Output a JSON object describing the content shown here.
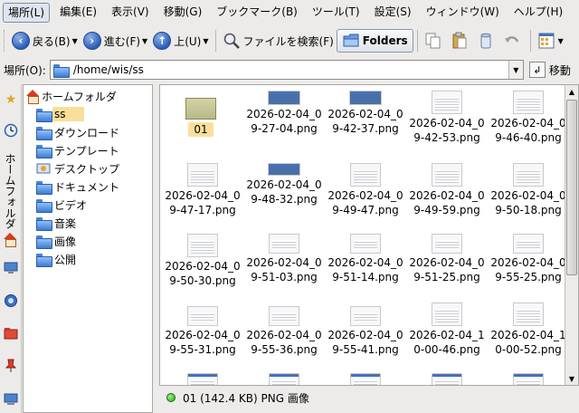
{
  "menubar": {
    "items": [
      {
        "label": "場所(L)"
      },
      {
        "label": "編集(E)"
      },
      {
        "label": "表示(V)"
      },
      {
        "label": "移動(G)"
      },
      {
        "label": "ブックマーク(B)"
      },
      {
        "label": "ツール(T)"
      },
      {
        "label": "設定(S)"
      },
      {
        "label": "ウィンドウ(W)"
      },
      {
        "label": "ヘルプ(H)"
      }
    ]
  },
  "toolbar": {
    "back_label": "戻る(B)",
    "forward_label": "進む(F)",
    "up_label": "上(U)",
    "search_label": "ファイルを検索(F)",
    "folders_label": "Folders"
  },
  "location": {
    "label": "場所(O):",
    "path": "/home/wis/ss",
    "go_label": "移動"
  },
  "sidebar": {
    "tab_label": "ホームフォルダ"
  },
  "tree": {
    "root": "ホームフォルダ",
    "items": [
      {
        "label": "ss"
      },
      {
        "label": "ダウンロード"
      },
      {
        "label": "テンプレート"
      },
      {
        "label": "デスクトップ"
      },
      {
        "label": "ドキュメント"
      },
      {
        "label": "ビデオ"
      },
      {
        "label": "音楽"
      },
      {
        "label": "画像"
      },
      {
        "label": "公開"
      }
    ]
  },
  "files": [
    {
      "name": "01"
    },
    {
      "name": "2026-02-04_09-27-04.png"
    },
    {
      "name": "2026-02-04_09-42-37.png"
    },
    {
      "name": "2026-02-04_09-42-53.png"
    },
    {
      "name": "2026-02-04_09-46-40.png"
    },
    {
      "name": "2026-02-04_09-47-17.png"
    },
    {
      "name": "2026-02-04_09-48-32.png"
    },
    {
      "name": "2026-02-04_09-49-47.png"
    },
    {
      "name": "2026-02-04_09-49-59.png"
    },
    {
      "name": "2026-02-04_09-50-18.png"
    },
    {
      "name": "2026-02-04_09-50-30.png"
    },
    {
      "name": "2026-02-04_09-51-03.png"
    },
    {
      "name": "2026-02-04_09-51-14.png"
    },
    {
      "name": "2026-02-04_09-51-25.png"
    },
    {
      "name": "2026-02-04_09-55-25.png"
    },
    {
      "name": "2026-02-04_09-55-31.png"
    },
    {
      "name": "2026-02-04_09-55-36.png"
    },
    {
      "name": "2026-02-04_09-55-41.png"
    },
    {
      "name": "2026-02-04_10-00-46.png"
    },
    {
      "name": "2026-02-04_10-00-52.png"
    }
  ],
  "status": {
    "text": "01 (142.4 KB)  PNG 画像"
  }
}
